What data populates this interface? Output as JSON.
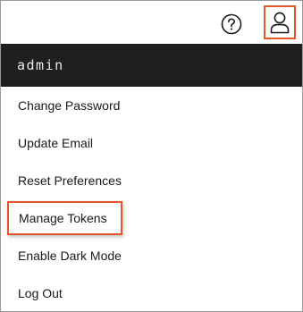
{
  "topbar": {
    "help_icon": "question-circle-icon",
    "user_icon": "user-icon",
    "accent_color": "#e2572a"
  },
  "menu": {
    "username": "admin",
    "items": [
      {
        "label": "Change Password"
      },
      {
        "label": "Update Email"
      },
      {
        "label": "Reset Preferences"
      },
      {
        "label": "Manage Tokens"
      },
      {
        "label": "Enable Dark Mode"
      },
      {
        "label": "Log Out"
      }
    ]
  }
}
